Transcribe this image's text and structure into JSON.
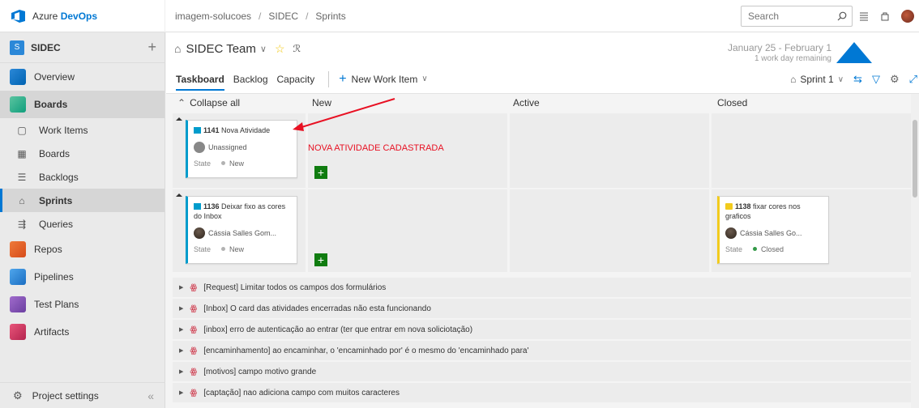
{
  "brand": {
    "prefix": "Azure ",
    "name": "DevOps"
  },
  "breadcrumbs": [
    "imagem-solucoes",
    "SIDEC",
    "Sprints"
  ],
  "search": {
    "placeholder": "Search"
  },
  "sidebar": {
    "project": {
      "badge": "S",
      "name": "SIDEC"
    },
    "items": [
      {
        "label": "Overview"
      },
      {
        "label": "Boards"
      },
      {
        "label": "Work Items"
      },
      {
        "label": "Boards"
      },
      {
        "label": "Backlogs"
      },
      {
        "label": "Sprints"
      },
      {
        "label": "Queries"
      },
      {
        "label": "Repos"
      },
      {
        "label": "Pipelines"
      },
      {
        "label": "Test Plans"
      },
      {
        "label": "Artifacts"
      }
    ],
    "settings_label": "Project settings"
  },
  "header": {
    "team": "SIDEC Team",
    "sprint_dates": "January 25 - February 1",
    "sprint_remaining": "1 work day remaining"
  },
  "tabs": [
    "Taskboard",
    "Backlog",
    "Capacity"
  ],
  "new_work_item": "New Work Item",
  "sprint_picker": "Sprint 1",
  "board": {
    "collapse_all": "Collapse all",
    "columns": [
      "New",
      "Active",
      "Closed"
    ],
    "annotation": "NOVA ATIVIDADE CADASTRADA",
    "state_label": "State",
    "cards": [
      {
        "id": "1141",
        "title": "Nova Atividade",
        "assignee": "Unassigned",
        "state": "New"
      },
      {
        "id": "1136",
        "title": "Deixar fixo as cores do Inbox",
        "assignee": "Cássia Salles Gom...",
        "state": "New"
      },
      {
        "id": "1138",
        "title": "fixar cores nos graficos",
        "assignee": "Cássia Salles Go...",
        "state": "Closed"
      }
    ],
    "collapsed_rows": [
      "[Request] Limitar todos os campos dos formulários",
      "[Inbox] O card das atividades encerradas não esta funcionando",
      "[inbox] erro de autenticação ao entrar (ter que entrar em nova soliciotação)",
      "[encaminhamento] ao encaminhar, o 'encaminhado por' é o mesmo do 'encaminhado para'",
      "[motivos] campo motivo grande",
      "[captação] nao adiciona campo com muitos caracteres"
    ]
  },
  "colors": {
    "accent": "#0078d4",
    "annotation": "#e81123",
    "add_button": "#107c10"
  }
}
